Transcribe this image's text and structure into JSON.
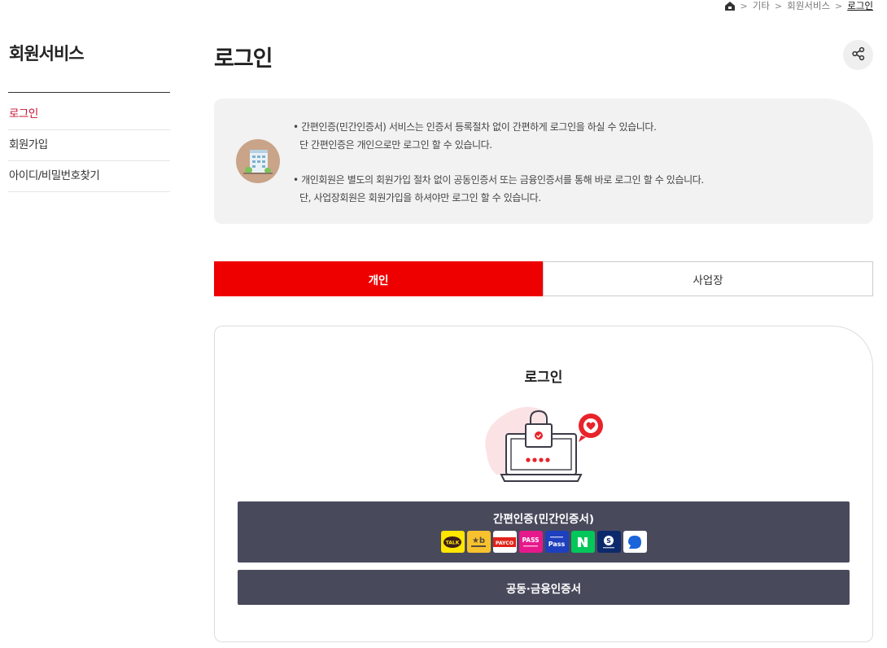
{
  "breadcrumb": {
    "home_icon": "home-icon",
    "items": [
      "기타",
      "회원서비스",
      "로그인"
    ]
  },
  "sidebar": {
    "title": "회원서비스",
    "items": [
      {
        "label": "로그인",
        "active": true
      },
      {
        "label": "회원가입",
        "active": false
      },
      {
        "label": "아이디/비밀번호찾기",
        "active": false
      }
    ]
  },
  "page": {
    "title": "로그인",
    "share_icon": "share-icon"
  },
  "info": {
    "icon": "building-icon",
    "lines": [
      "• 간편인증(민간인증서) 서비스는 인증서 등록절차 없이 간편하게 로그인을 하실 수 있습니다.",
      "단 간편인증은 개인으로만 로그인 할 수 있습니다.",
      "• 개인회원은 별도의 회원가입 절차 없이 공동인증서 또는 금융인증서를 통해 바로 로그인 할 수 있습니다.",
      "단, 사업장회원은 회원가입을 하셔야만 로그인 할 수 있습니다."
    ]
  },
  "tabs": [
    {
      "label": "개인",
      "active": true
    },
    {
      "label": "사업장",
      "active": false
    }
  ],
  "login": {
    "title": "로그인",
    "illustration": "laptop-lock-icon",
    "simple_auth_label": "간편인증(민간인증서)",
    "providers": [
      {
        "name": "kakao-talk-icon",
        "text": "TALK",
        "bg": "#ffe500",
        "fg": "#3a1d1d"
      },
      {
        "name": "kb-icon",
        "text": "★b",
        "bg": "#f7c22d",
        "fg": "#5a4a3a"
      },
      {
        "name": "payco-icon",
        "text": "PAYCO",
        "bg": "#ffffff",
        "fg": "#e0241a"
      },
      {
        "name": "pass-icon",
        "text": "PASS",
        "bg": "#e6198c",
        "fg": "#ffffff"
      },
      {
        "name": "samsung-pass-icon",
        "text": "Pass",
        "bg": "#1e3fbe",
        "fg": "#ffffff"
      },
      {
        "name": "naver-icon",
        "text": "N",
        "bg": "#03c75a",
        "fg": "#ffffff"
      },
      {
        "name": "shinhan-icon",
        "text": "S",
        "bg": "#0c2a6b",
        "fg": "#ffffff"
      },
      {
        "name": "toss-icon",
        "text": "",
        "bg": "#ffffff",
        "fg": "#1b64da"
      }
    ],
    "cert_label": "공동·금융인증서"
  },
  "colors": {
    "accent": "#ef0000",
    "active_menu": "#c8102e",
    "button_bg": "#484a5c",
    "info_bg": "#f2f2f2"
  }
}
